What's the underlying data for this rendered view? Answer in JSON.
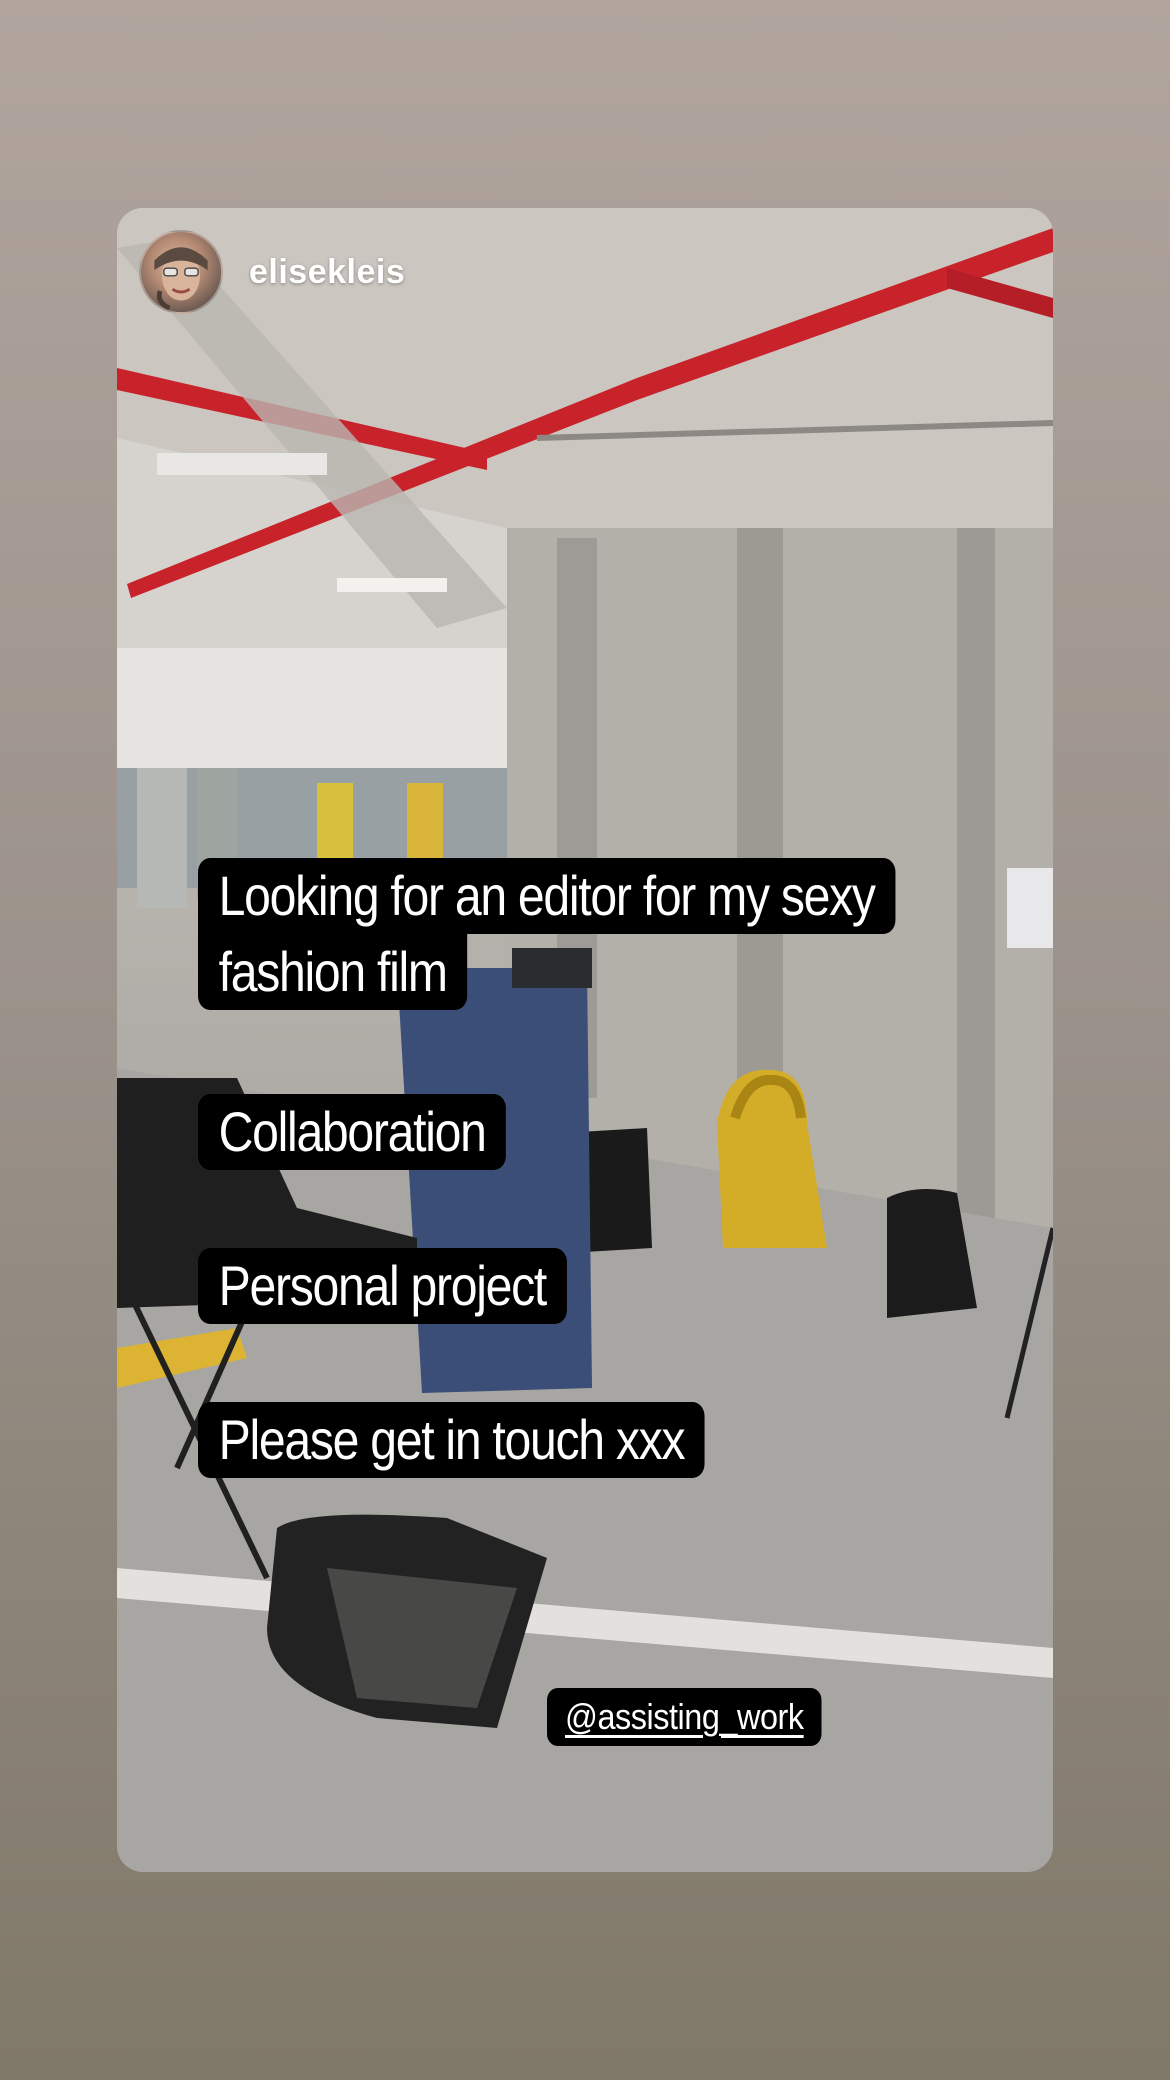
{
  "story": {
    "username": "elisekleis",
    "captions": [
      {
        "lines": [
          "Looking for an editor for my sexy",
          "fashion film"
        ]
      },
      {
        "lines": [
          "Collaboration"
        ]
      },
      {
        "lines": [
          "Personal project"
        ]
      },
      {
        "lines": [
          "Please get in touch xxx"
        ]
      }
    ],
    "mention": "@assisting_work"
  },
  "colors": {
    "background_top": "#b1a59e",
    "background_bottom": "#807868",
    "caption_background": "#000000",
    "caption_text": "#ffffff",
    "pipe_red": "#c8232b",
    "bag_yellow": "#d4ad28"
  },
  "icons": [
    "avatar-photo"
  ]
}
